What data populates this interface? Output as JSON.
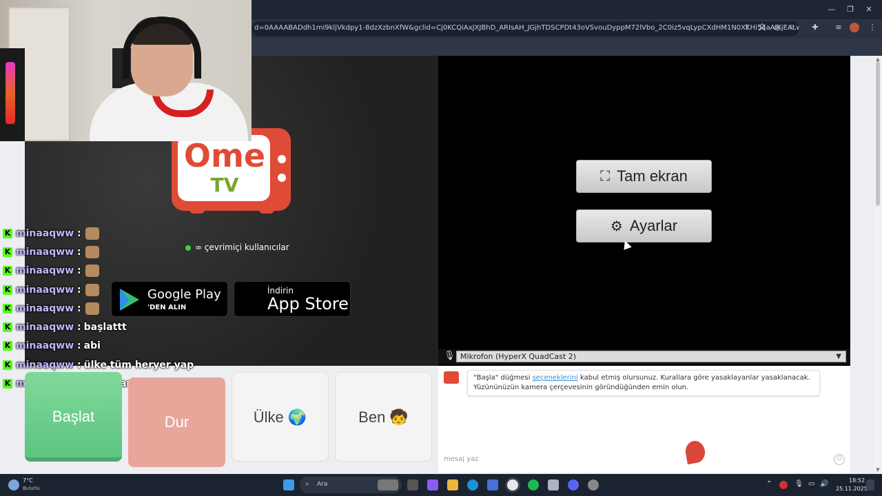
{
  "browser": {
    "url": "d=0AAAABADdh1mi9kljVkdpy1-8dzXzbnXfW&gclid=Cj0KCQiAxJXJBhD_ARIsAH_JGjhTDSCPDt43oVSvouDyppM72lVbo_2C0iz5vqLypCXdHM1N0XKHi54aAlKjEALw_wcB"
  },
  "ometv": {
    "logo_ome": "Ome",
    "logo_tv": "TV",
    "online_text": "∞ çevrimiçi kullanıcılar",
    "google_play_big": "Google Play",
    "google_play_small": "'DEN ALIN",
    "app_store_small": "İndirin",
    "app_store_big": "App Store"
  },
  "video_controls": {
    "fullscreen_label": "Tam ekran",
    "settings_label": "Ayarlar",
    "microphone": "Mikrofon (HyperX QuadCast 2)"
  },
  "actions": {
    "start": "Başlat",
    "stop": "Dur",
    "country": "Ülke 🌍",
    "me": "Ben 🧒"
  },
  "chat": {
    "system_pre": "\"Başla\" düğmesi ",
    "system_link": "seçeneklerini",
    "system_post": " kabul etmiş olursunuz. Kurallara göre yasaklayanlar yasaklanacak. Yüzününüzün kamera çerçevesinin göründüğünden emin olun.",
    "input_placeholder": "mesaj yaz"
  },
  "stream_chat": [
    {
      "user": "minaaqww",
      "msg": "",
      "emote": true
    },
    {
      "user": "minaaqww",
      "msg": "",
      "emote": true
    },
    {
      "user": "minaaqww",
      "msg": "",
      "emote": true
    },
    {
      "user": "minaaqww",
      "msg": "",
      "emote": true
    },
    {
      "user": "minaaqww",
      "msg": "",
      "emote": true
    },
    {
      "user": "minaaqww",
      "msg": "başlattt",
      "emote": false
    },
    {
      "user": "minaaqww",
      "msg": "abi",
      "emote": false
    },
    {
      "user": "minaaqww",
      "msg": "ülke tüm heryer yap",
      "emote": false
    },
    {
      "user": "minaaqww",
      "msg": "site ayarlarından değiştir",
      "emote": false
    }
  ],
  "taskbar": {
    "weather_temp": "7°C",
    "weather_desc": "Bulutlu",
    "search_label": "Ara",
    "time": "18:52",
    "date": "25.11.2025"
  },
  "colors": {
    "start_green": "#6fcf8f",
    "stop_red": "#e8a69b",
    "brand_red": "#e04b37",
    "kick_green": "#53fc18"
  }
}
